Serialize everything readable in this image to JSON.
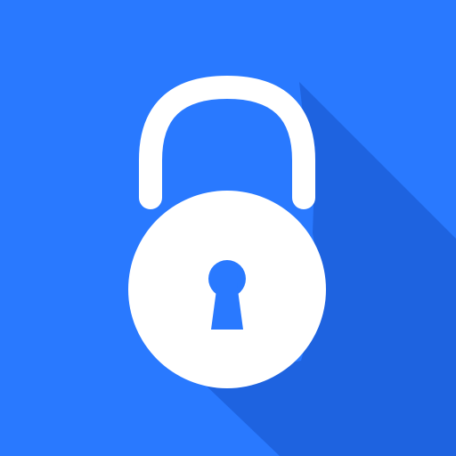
{
  "icon": {
    "name": "padlock-icon",
    "colors": {
      "background": "#2979FF",
      "shadow": "#1E63E0",
      "lock": "#FFFFFF",
      "keyhole": "#2979FF"
    }
  }
}
